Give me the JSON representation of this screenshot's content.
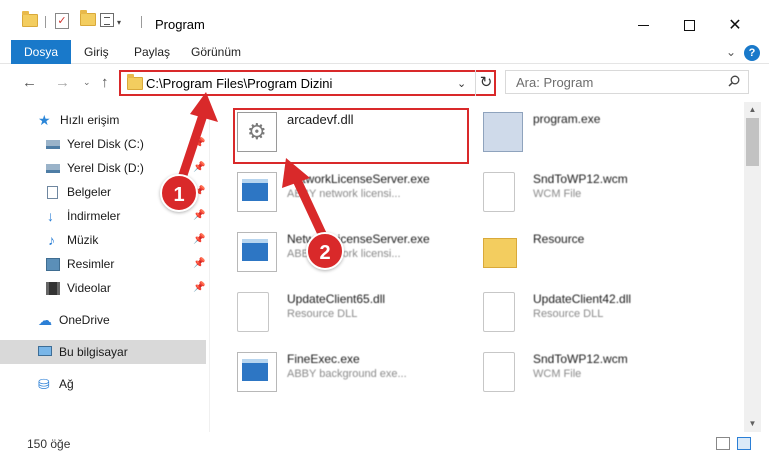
{
  "window": {
    "title": "Program",
    "minimize_icon": "minimize-icon",
    "maximize_icon": "maximize-icon",
    "close_glyph": "✕"
  },
  "quick_access_toolbar": {
    "check_glyph": "✓",
    "dropdown_glyph": "▾"
  },
  "ribbon": {
    "tabs": [
      {
        "label": "Dosya",
        "active": true
      },
      {
        "label": "Giriş"
      },
      {
        "label": "Paylaş"
      },
      {
        "label": "Görünüm"
      }
    ],
    "expand_glyph": "⌄",
    "help_glyph": "?"
  },
  "navigation": {
    "back_glyph": "←",
    "forward_glyph": "→",
    "recent_glyph": "⌄",
    "up_glyph": "↑"
  },
  "address_bar": {
    "path": "C:\\Program Files\\Program Dizini",
    "dropdown_glyph": "⌄",
    "refresh_glyph": "↻"
  },
  "search": {
    "placeholder": "Ara: Program"
  },
  "sidebar": {
    "pin_glyph": "📌",
    "items": [
      {
        "label": "Hızlı erişim",
        "icon": "star-icon",
        "glyph": "★"
      },
      {
        "label": "Yerel Disk (C:)",
        "icon": "disk-icon",
        "pinned": true
      },
      {
        "label": "Yerel Disk (D:)",
        "icon": "disk-icon",
        "pinned": true
      },
      {
        "label": "Belgeler",
        "icon": "documents-icon",
        "pinned": true
      },
      {
        "label": "İndirmeler",
        "icon": "download-icon",
        "glyph": "↓",
        "pinned": true
      },
      {
        "label": "Müzik",
        "icon": "music-icon",
        "glyph": "♪",
        "pinned": true
      },
      {
        "label": "Resimler",
        "icon": "pictures-icon",
        "pinned": true
      },
      {
        "label": "Videolar",
        "icon": "videos-icon",
        "pinned": true
      },
      {
        "label": "OneDrive",
        "icon": "cloud-icon",
        "glyph": "☁"
      },
      {
        "label": "Bu bilgisayar",
        "icon": "computer-icon",
        "selected": true
      },
      {
        "label": "Ağ",
        "icon": "network-icon",
        "glyph": "⛁"
      }
    ]
  },
  "files": [
    {
      "name": "arcadevf.dll",
      "description": "",
      "icon": "dll-file-icon"
    },
    {
      "name": "program.exe",
      "description": "",
      "icon": "program-exe-icon"
    },
    {
      "name": "NetworkLicenseServer.exe",
      "description": "ABBY network licensi...",
      "icon": "exe-file-icon"
    },
    {
      "name": "SndToWP12.wcm",
      "description": "WCM File",
      "icon": "wcm-file-icon"
    },
    {
      "name": "NetworkLicenseServer.exe",
      "description": "ABBY network licensi...",
      "icon": "exe-file-icon"
    },
    {
      "name": "Resource",
      "description": "",
      "icon": "folder-icon"
    },
    {
      "name": "UpdateClient65.dll",
      "description": "Resource DLL",
      "icon": "dll-file-icon"
    },
    {
      "name": "UpdateClient42.dll",
      "description": "Resource DLL",
      "icon": "dll-file-icon"
    },
    {
      "name": "FineExec.exe",
      "description": "ABBY background exe...",
      "icon": "exe-file-icon"
    },
    {
      "name": "SndToWP12.wcm",
      "description": "WCM File",
      "icon": "wcm-file-icon"
    }
  ],
  "scrollbar": {
    "up_glyph": "▲",
    "down_glyph": "▼"
  },
  "status": {
    "item_count": "150 öğe"
  },
  "annotations": {
    "step1": "1",
    "step2": "2",
    "color": "#d9292a"
  },
  "colors": {
    "accent": "#1979ca",
    "highlight": "#d9292a"
  }
}
